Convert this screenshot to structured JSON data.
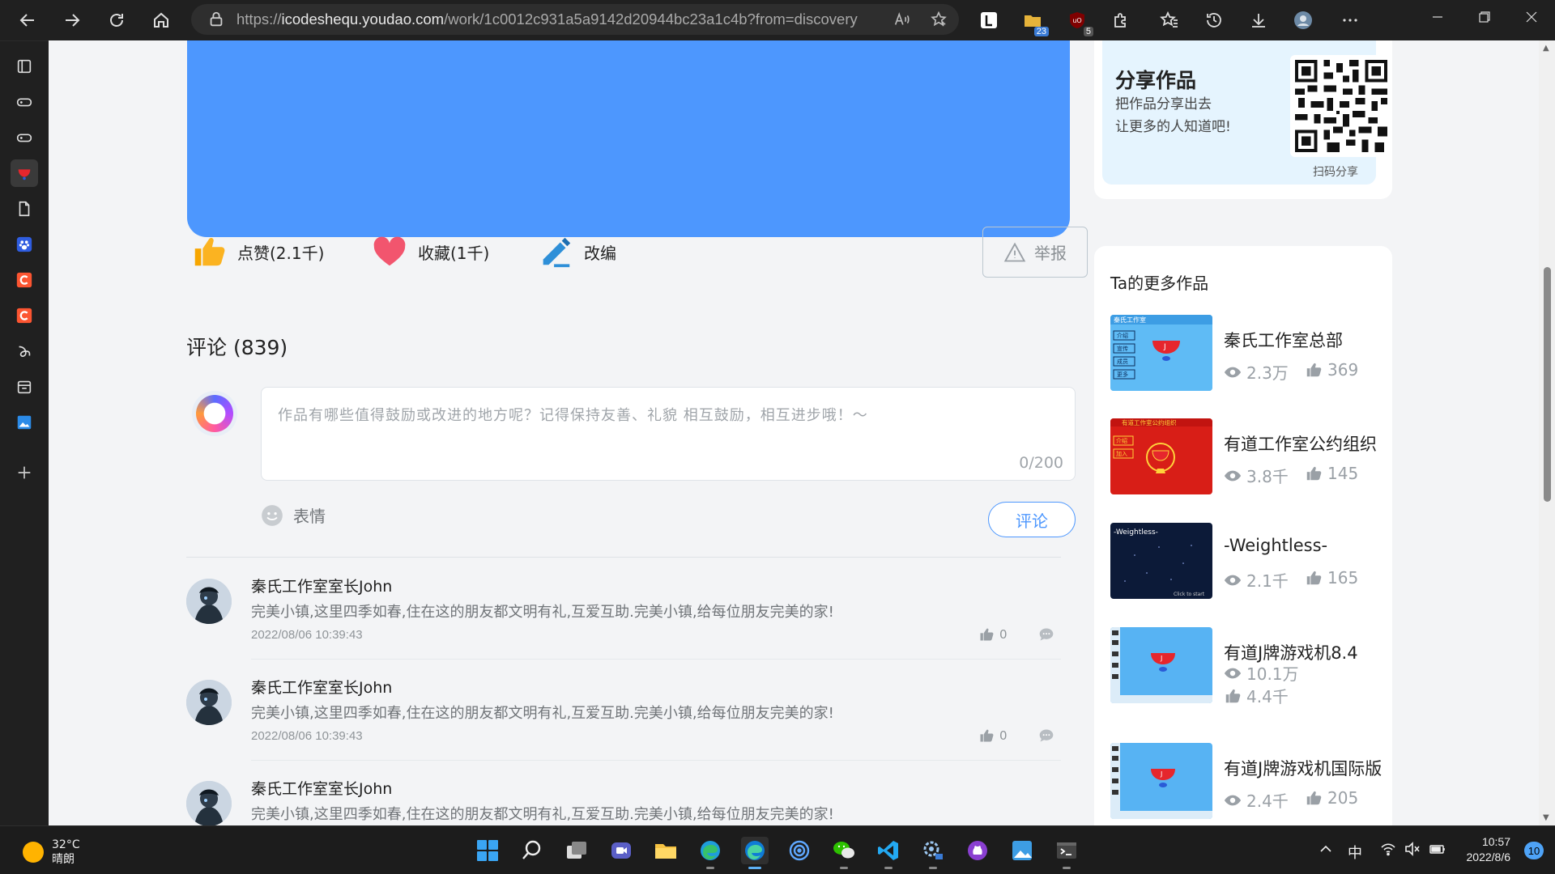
{
  "browser": {
    "url_prefix": "https://",
    "url_host": "icodeshequ.youdao.com",
    "url_path": "/work/1c0012c931a5a9142d20944bc23a1c4b?from=discovery",
    "extension_badge_1": "23",
    "extension_badge_2": "5"
  },
  "share": {
    "title": "分享作品",
    "line1": "把作品分享出去",
    "line2": "让更多的人知道吧!",
    "qr_label": "扫码分享"
  },
  "actions": {
    "like_label": "点赞(2.1千)",
    "favorite_label": "收藏(1千)",
    "remix_label": "改编",
    "report_label": "举报"
  },
  "comments": {
    "title": "评论 (839)",
    "placeholder": "作品有哪些值得鼓励或改进的地方呢？记得保持友善、礼貌 相互鼓励，相互进步哦！～",
    "char_count": "0/200",
    "emoji_label": "表情",
    "submit_label": "评论",
    "items": [
      {
        "name": "秦氏工作室室长John",
        "text": "完美小镇,这里四季如春,住在这的朋友都文明有礼,互爱互助.完美小镇,给每位朋友完美的家!",
        "time": "2022/08/06 10:39:43",
        "likes": "0"
      },
      {
        "name": "秦氏工作室室长John",
        "text": "完美小镇,这里四季如春,住在这的朋友都文明有礼,互爱互助.完美小镇,给每位朋友完美的家!",
        "time": "2022/08/06 10:39:43",
        "likes": "0"
      },
      {
        "name": "秦氏工作室室长John",
        "text": "完美小镇,这里四季如春,住在这的朋友都文明有礼,互爱互助.完美小镇,给每位朋友完美的家!"
      }
    ]
  },
  "more_works": {
    "title": "Ta的更多作品",
    "items": [
      {
        "title": "秦氏工作室总部",
        "views": "2.3万",
        "likes": "369"
      },
      {
        "title": "有道工作室公约组织",
        "views": "3.8千",
        "likes": "145"
      },
      {
        "title": "-Weightless-",
        "views": "2.1千",
        "likes": "165"
      },
      {
        "title": "有道J牌游戏机8.4",
        "views": "10.1万",
        "likes": "4.4千"
      },
      {
        "title": "有道J牌游戏机国际版",
        "views": "2.4千",
        "likes": "205"
      }
    ]
  },
  "thumbs": {
    "t1_header": "秦氏工作室",
    "t1_buttons": [
      "介绍",
      "宣传",
      "成员",
      "更多"
    ],
    "t2_header": "有道工作室公约组织",
    "t2_buttons": [
      "介绍",
      "加入"
    ],
    "t3_title": "-Weightless-",
    "t3_hint": "Click to start"
  },
  "taskbar": {
    "temperature": "32°C",
    "weather": "晴朗",
    "ime": "中",
    "time": "10:57",
    "date": "2022/8/6",
    "notifications": "10"
  },
  "colors": {
    "accent": "#4d97fe",
    "like": "#f7a600",
    "favorite": "#f2556e"
  }
}
